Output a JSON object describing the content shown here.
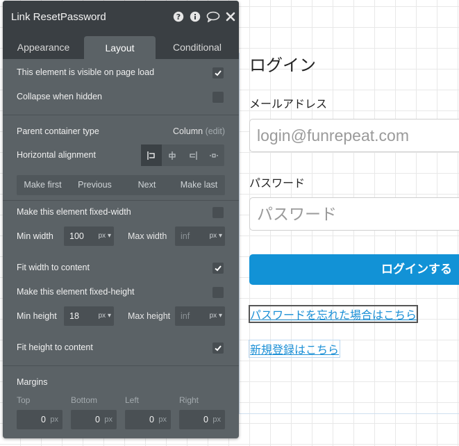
{
  "canvas": {
    "title": "ログイン",
    "email_label": "メールアドレス",
    "email_placeholder": "login@funrepeat.com",
    "password_label": "パスワード",
    "password_placeholder": "パスワード",
    "login_button": "ログインする",
    "reset_link": "パスワードを忘れた場合はこちら",
    "signup_link": "新規登録はこちら",
    "accent_color": "#1292d6"
  },
  "panel": {
    "title": "Link ResetPassword",
    "header_icons": [
      "help-icon",
      "info-icon",
      "comment-icon",
      "close-icon"
    ],
    "tabs": [
      {
        "label": "Appearance",
        "active": false
      },
      {
        "label": "Layout",
        "active": true
      },
      {
        "label": "Conditional",
        "active": false
      }
    ],
    "visible_on_load": {
      "label": "This element is visible on page load",
      "checked": true
    },
    "collapse_hidden": {
      "label": "Collapse when hidden",
      "checked": false
    },
    "parent_container": {
      "label": "Parent container type",
      "value": "Column",
      "edit": "(edit)"
    },
    "horizontal_alignment": {
      "label": "Horizontal alignment",
      "options": [
        "align-left-icon",
        "align-center-icon",
        "align-right-icon",
        "align-distribute-icon"
      ],
      "selected": 0
    },
    "order_buttons": [
      "Make first",
      "Previous",
      "Next",
      "Make last"
    ],
    "fixed_width": {
      "label": "Make this element fixed-width",
      "checked": false
    },
    "min_width": {
      "label": "Min width",
      "value": "100",
      "unit": "px"
    },
    "max_width": {
      "label": "Max width",
      "placeholder": "inf",
      "unit": "px"
    },
    "fit_width": {
      "label": "Fit width to content",
      "checked": true
    },
    "fixed_height": {
      "label": "Make this element fixed-height",
      "checked": false
    },
    "min_height": {
      "label": "Min height",
      "value": "18",
      "unit": "px"
    },
    "max_height": {
      "label": "Max height",
      "placeholder": "inf",
      "unit": "px"
    },
    "fit_height": {
      "label": "Fit height to content",
      "checked": true
    },
    "margins": {
      "label": "Margins",
      "fields": [
        {
          "label": "Top",
          "value": "0",
          "unit": "px"
        },
        {
          "label": "Bottom",
          "value": "0",
          "unit": "px"
        },
        {
          "label": "Left",
          "value": "0",
          "unit": "px"
        },
        {
          "label": "Right",
          "value": "0",
          "unit": "px"
        }
      ]
    }
  }
}
